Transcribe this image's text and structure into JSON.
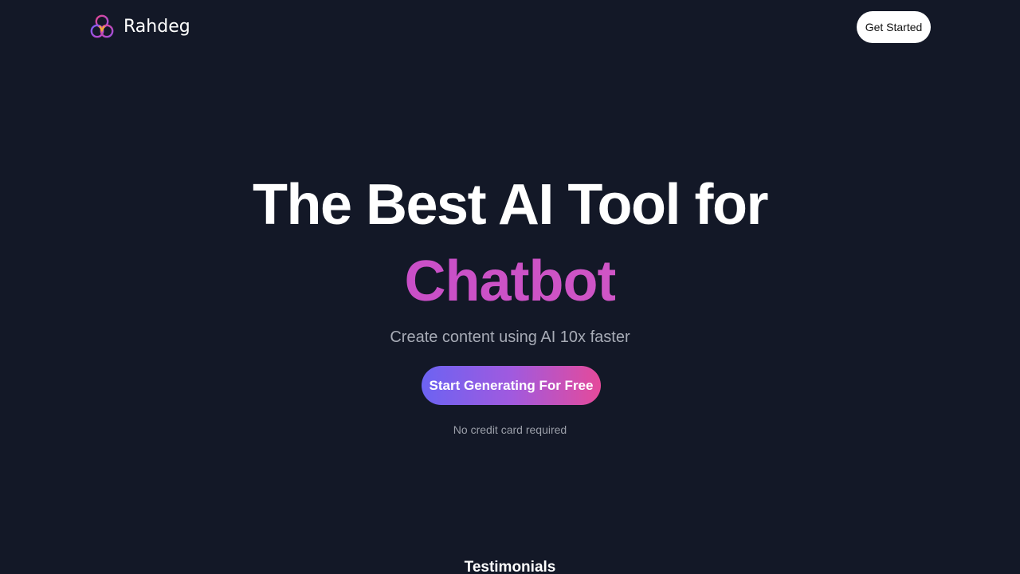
{
  "navbar": {
    "brand_name": "Rahdeg",
    "logo_icon": "interlocking-rings-logo-icon",
    "get_started_label": "Get Started"
  },
  "hero": {
    "title": "The Best AI Tool for",
    "highlight": "Chatbot",
    "subtitle": "Create content using AI 10x faster",
    "cta_label": "Start Generating For Free",
    "note": "No credit card required"
  },
  "sections": {
    "testimonials_heading": "Testimonials"
  },
  "colors": {
    "background": "#131827",
    "highlight": "#cb52c6",
    "cta_gradient_start": "#6c63f2",
    "cta_gradient_end": "#e54a9a",
    "button_background": "#ffffff"
  }
}
